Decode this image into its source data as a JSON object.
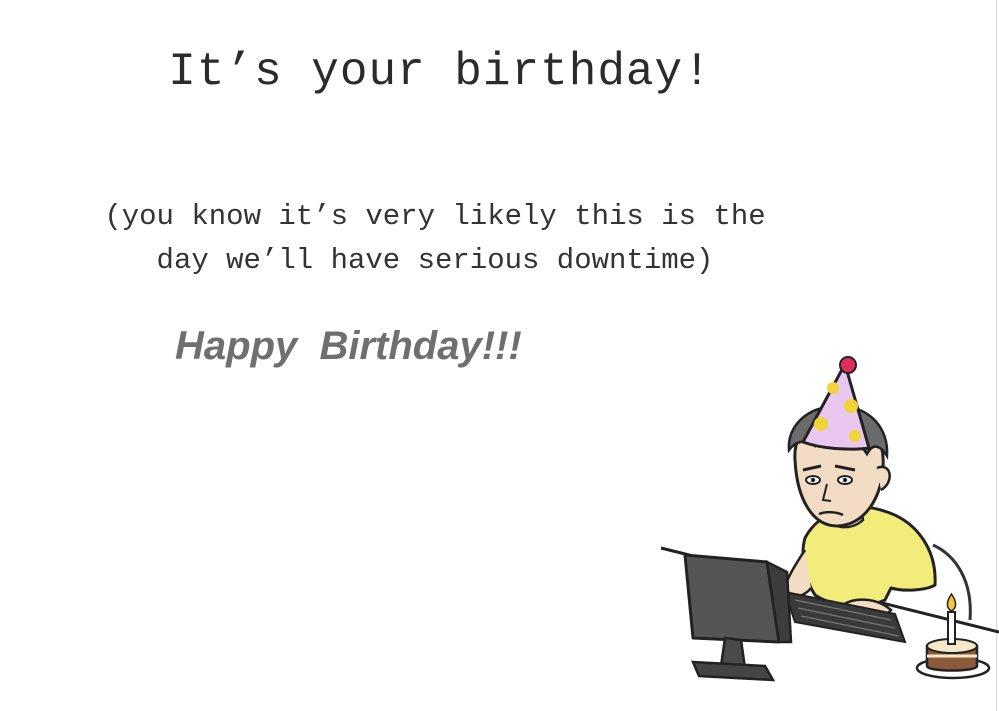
{
  "card": {
    "title": "It’s your birthday!",
    "subtitle_line1": "(you know it’s very likely this is the",
    "subtitle_line2": "day we’ll have serious downtime)",
    "greeting": "Happy  Birthday!!!"
  },
  "colors": {
    "background": "#ffffff",
    "title_text": "#2b2b2b",
    "greeting_text": "#6f6f6f",
    "shirt": "#f2ec7a",
    "party_hat": "#e9c7f0",
    "hat_dots": "#f0d43a",
    "pompom": "#e0305a",
    "monitor": "#555555",
    "cake": "#8a5a3a"
  },
  "illustration": {
    "icon": "sysadmin-at-computer-with-party-hat-icon"
  }
}
